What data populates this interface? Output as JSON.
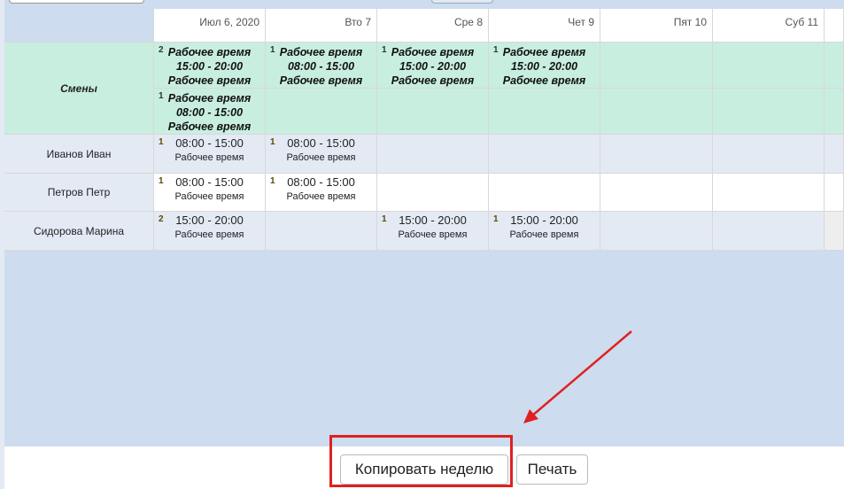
{
  "header": {
    "days": [
      "Июл 6, 2020",
      "Вто 7",
      "Сре 8",
      "Чет 9",
      "Пят 10",
      "Суб 11",
      ""
    ]
  },
  "shifts": {
    "label": "Смены",
    "row1": [
      {
        "count": "2",
        "lines": [
          "Рабочее время",
          "15:00 - 20:00",
          "Рабочее время"
        ]
      },
      {
        "count": "1",
        "lines": [
          "Рабочее время",
          "08:00 - 15:00",
          "Рабочее время"
        ]
      },
      {
        "count": "1",
        "lines": [
          "Рабочее время",
          "15:00 - 20:00",
          "Рабочее время"
        ]
      },
      {
        "count": "1",
        "lines": [
          "Рабочее время",
          "15:00 - 20:00",
          "Рабочее время"
        ]
      },
      null,
      null,
      null
    ],
    "row2": [
      {
        "count": "1",
        "lines": [
          "Рабочее время",
          "08:00 - 15:00",
          "Рабочее время"
        ]
      },
      null,
      null,
      null,
      null,
      null,
      null
    ]
  },
  "employees": [
    {
      "name": "Иванов Иван",
      "cells": [
        {
          "count": "1",
          "time": "08:00 - 15:00",
          "label": "Рабочее время"
        },
        {
          "count": "1",
          "time": "08:00 - 15:00",
          "label": "Рабочее время"
        },
        null,
        null,
        null,
        null,
        null
      ]
    },
    {
      "name": "Петров Петр",
      "cells": [
        {
          "count": "1",
          "time": "08:00 - 15:00",
          "label": "Рабочее время"
        },
        {
          "count": "1",
          "time": "08:00 - 15:00",
          "label": "Рабочее время"
        },
        null,
        null,
        null,
        null,
        null
      ]
    },
    {
      "name": "Сидорова Марина",
      "cells": [
        {
          "count": "2",
          "time": "15:00 - 20:00",
          "label": "Рабочее время"
        },
        null,
        {
          "count": "1",
          "time": "15:00 - 20:00",
          "label": "Рабочее время"
        },
        {
          "count": "1",
          "time": "15:00 - 20:00",
          "label": "Рабочее время"
        },
        null,
        null,
        null
      ]
    }
  ],
  "footer": {
    "copy_week": "Копировать неделю",
    "print": "Печать"
  },
  "colors": {
    "annotation": "#e02020",
    "shift_bg": "#c8eee0",
    "main_bg": "#cddcee"
  }
}
